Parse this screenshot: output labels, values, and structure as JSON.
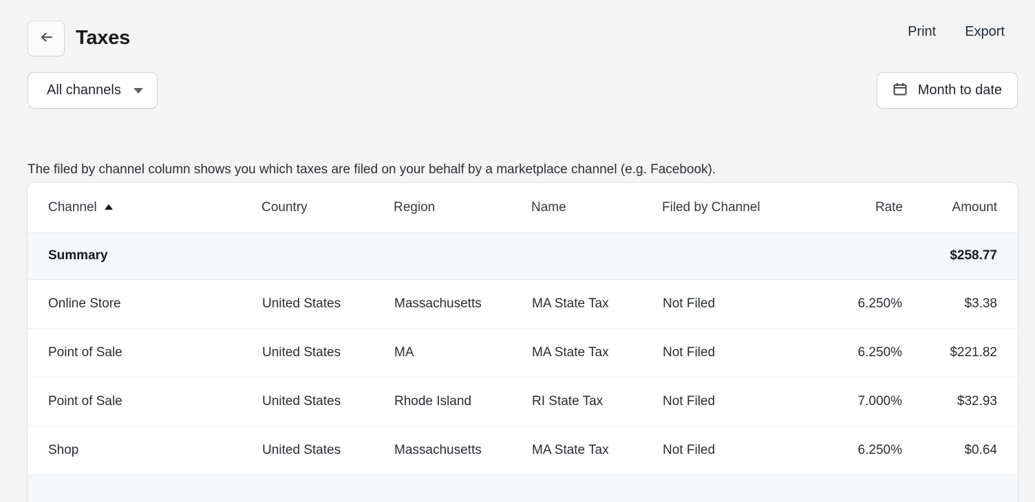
{
  "header": {
    "back_icon": "arrow-left-icon",
    "title": "Taxes",
    "print_label": "Print",
    "export_label": "Export"
  },
  "filters": {
    "channel_label": "All channels",
    "channel_caret_icon": "chevron-down-icon",
    "date_icon": "calendar-icon",
    "date_label": "Month to date"
  },
  "description": "The filed by channel column shows you which taxes are filed on your behalf by a marketplace channel (e.g. Facebook).",
  "table": {
    "columns": [
      {
        "key": "channel",
        "label": "Channel",
        "align": "left",
        "sorted": "asc",
        "sort_icon": "sort-ascending-triangle-icon"
      },
      {
        "key": "country",
        "label": "Country",
        "align": "left"
      },
      {
        "key": "region",
        "label": "Region",
        "align": "left"
      },
      {
        "key": "name",
        "label": "Name",
        "align": "left"
      },
      {
        "key": "filed_by_channel",
        "label": "Filed by Channel",
        "align": "left"
      },
      {
        "key": "rate",
        "label": "Rate",
        "align": "right"
      },
      {
        "key": "amount",
        "label": "Amount",
        "align": "right"
      }
    ],
    "summary": {
      "label": "Summary",
      "country": "",
      "region": "",
      "name": "",
      "filed_by_channel": "",
      "rate": "",
      "amount": "$258.77"
    },
    "rows": [
      {
        "channel": "Online Store",
        "country": "United States",
        "region": "Massachusetts",
        "name": "MA State Tax",
        "filed_by_channel": "Not Filed",
        "rate": "6.250%",
        "amount": "$3.38"
      },
      {
        "channel": "Point of Sale",
        "country": "United States",
        "region": "MA",
        "name": "MA State Tax",
        "filed_by_channel": "Not Filed",
        "rate": "6.250%",
        "amount": "$221.82"
      },
      {
        "channel": "Point of Sale",
        "country": "United States",
        "region": "Rhode Island",
        "name": "RI State Tax",
        "filed_by_channel": "Not Filed",
        "rate": "7.000%",
        "amount": "$32.93"
      },
      {
        "channel": "Shop",
        "country": "United States",
        "region": "Massachusetts",
        "name": "MA State Tax",
        "filed_by_channel": "Not Filed",
        "rate": "6.250%",
        "amount": "$0.64"
      }
    ]
  },
  "colors": {
    "page_background": "#f4f4f4",
    "card_background": "#ffffff",
    "summary_row_background": "#f5f8fb",
    "text_primary": "#202223",
    "border": "#e6e8ea"
  }
}
